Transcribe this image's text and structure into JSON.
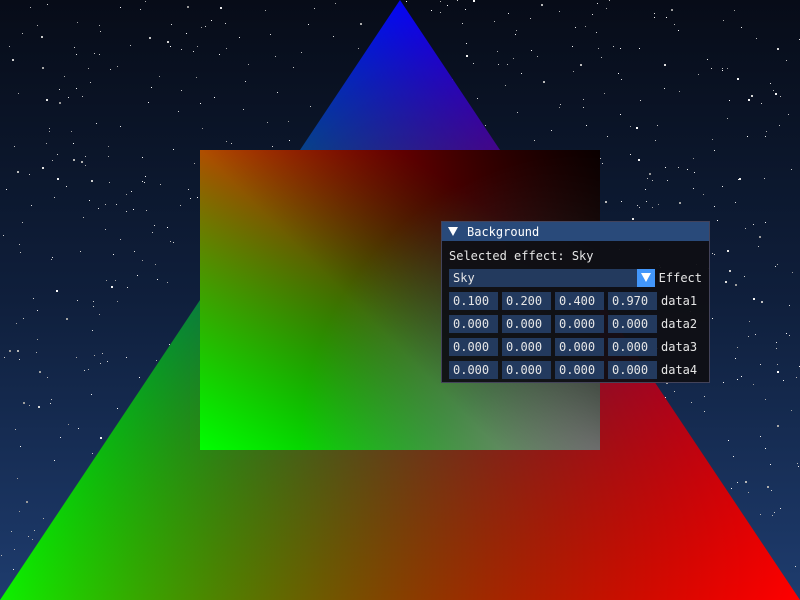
{
  "window": {
    "title": "Background",
    "selected_effect_text": "Selected effect: Sky",
    "combo": {
      "value": "Sky",
      "label": "Effect"
    },
    "rows": [
      {
        "label": "data1",
        "values": [
          "0.100",
          "0.200",
          "0.400",
          "0.970"
        ]
      },
      {
        "label": "data2",
        "values": [
          "0.000",
          "0.000",
          "0.000",
          "0.000"
        ]
      },
      {
        "label": "data3",
        "values": [
          "0.000",
          "0.000",
          "0.000",
          "0.000"
        ]
      },
      {
        "label": "data4",
        "values": [
          "0.000",
          "0.000",
          "0.000",
          "0.000"
        ]
      }
    ]
  },
  "colors": {
    "title_bar": "#294a7a",
    "frame_bg": "#233a5e",
    "accent": "#4296fa",
    "window_bg": "#0f0f14"
  },
  "icons": [
    "collapse-arrow-icon",
    "combo-arrow-icon"
  ]
}
